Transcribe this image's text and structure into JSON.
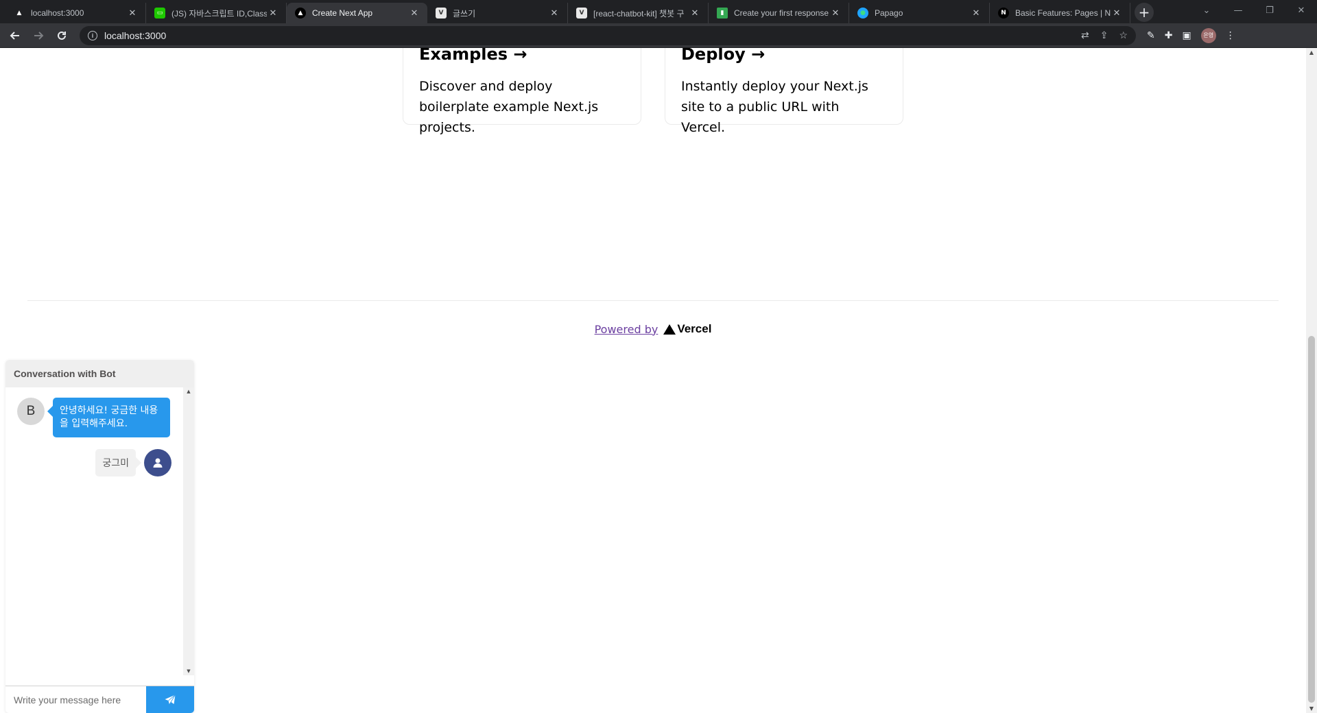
{
  "browser": {
    "tabs": [
      {
        "title": "localhost:3000",
        "favicon_color": "#202124",
        "favicon_glyph": "▲",
        "active": false
      },
      {
        "title": "(JS) 자바스크립트 ID,Class",
        "favicon_color": "#1ec800",
        "favicon_glyph": "▭",
        "active": false
      },
      {
        "title": "Create Next App",
        "favicon_color": "#000000",
        "favicon_glyph": "▲",
        "active": true
      },
      {
        "title": "글쓰기",
        "favicon_color": "#e8e8e8",
        "favicon_glyph": "V",
        "active": false
      },
      {
        "title": "[react-chatbot-kit] 챗봇 구",
        "favicon_color": "#e8e8e8",
        "favicon_glyph": "V",
        "active": false
      },
      {
        "title": "Create your first response",
        "favicon_color": "#34a853",
        "favicon_glyph": "▮",
        "active": false
      },
      {
        "title": "Papago",
        "favicon_color": "#1fa5ff",
        "favicon_glyph": "●",
        "active": false
      },
      {
        "title": "Basic Features: Pages | Ne",
        "favicon_color": "#000000",
        "favicon_glyph": "N",
        "active": false
      }
    ],
    "tab_close_glyph": "✕",
    "new_tab_glyph": "+",
    "address": "localhost:3000",
    "avatar_text": "은영"
  },
  "page": {
    "cards": [
      {
        "title": "Examples →",
        "text": "Discover and deploy boilerplate example Next.js projects."
      },
      {
        "title": "Deploy →",
        "text": "Instantly deploy your Next.js site to a public URL with Vercel."
      }
    ],
    "footer": {
      "powered_by": "Powered by",
      "brand": "Vercel"
    }
  },
  "chatbot": {
    "header": "Conversation with Bot",
    "bot_avatar_letter": "B",
    "messages": [
      {
        "from": "bot",
        "text": "안녕하세요! 궁금한 내용을 입력해주세요."
      },
      {
        "from": "user",
        "text": "궁그미"
      }
    ],
    "input_placeholder": "Write your message here",
    "colors": {
      "accent": "#2898ec",
      "user_avatar": "#3d4e8d"
    }
  }
}
